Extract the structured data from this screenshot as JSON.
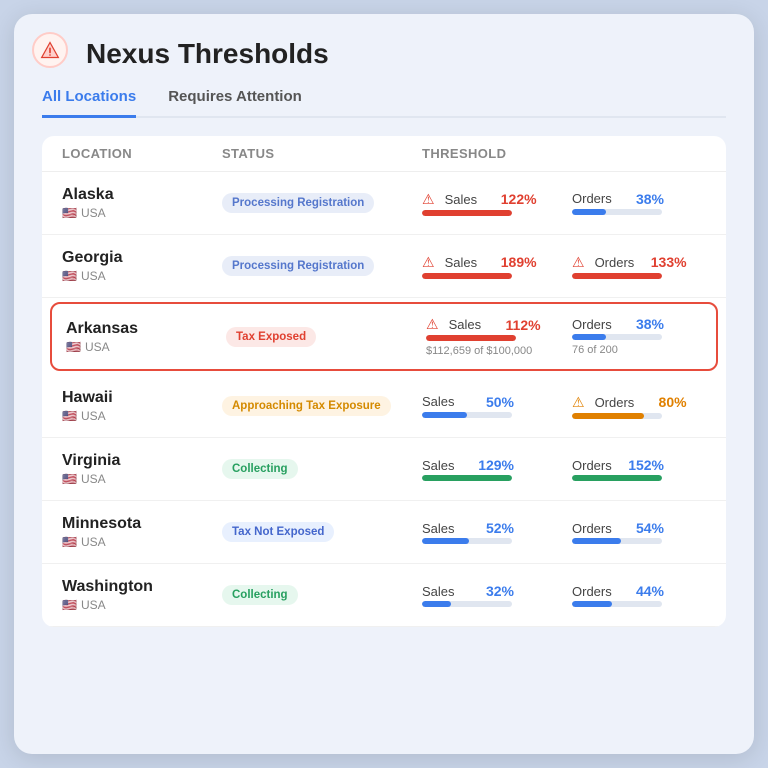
{
  "title": "Nexus Thresholds",
  "tabs": [
    {
      "label": "All Locations",
      "active": true
    },
    {
      "label": "Requires Attention",
      "active": false
    }
  ],
  "columns": [
    "Location",
    "Status",
    "Threshold"
  ],
  "rows": [
    {
      "location": "Alaska",
      "country": "USA",
      "flag": "🇺🇸",
      "status": "Processing Registration",
      "status_class": "badge-processing",
      "highlighted": false,
      "metrics": [
        {
          "label": "Sales",
          "pct": "122%",
          "pct_class": "red",
          "bar": 100,
          "bar_class": "red",
          "warn": true,
          "warn_type": "red"
        },
        {
          "label": "Orders",
          "pct": "38%",
          "pct_class": "blue",
          "bar": 38,
          "bar_class": "blue",
          "warn": false
        }
      ]
    },
    {
      "location": "Georgia",
      "country": "USA",
      "flag": "🇺🇸",
      "status": "Processing Registration",
      "status_class": "badge-processing",
      "highlighted": false,
      "metrics": [
        {
          "label": "Sales",
          "pct": "189%",
          "pct_class": "red",
          "bar": 100,
          "bar_class": "red",
          "warn": true,
          "warn_type": "red"
        },
        {
          "label": "Orders",
          "pct": "133%",
          "pct_class": "red",
          "bar": 100,
          "bar_class": "red",
          "warn": true,
          "warn_type": "red"
        }
      ]
    },
    {
      "location": "Arkansas",
      "country": "USA",
      "flag": "🇺🇸",
      "status": "Tax Exposed",
      "status_class": "badge-tax-exposed",
      "highlighted": true,
      "metrics": [
        {
          "label": "Sales",
          "pct": "112%",
          "pct_class": "red",
          "bar": 100,
          "bar_class": "red",
          "warn": true,
          "warn_type": "red",
          "sub": "$112,659 of $100,000"
        },
        {
          "label": "Orders",
          "pct": "38%",
          "pct_class": "blue",
          "bar": 38,
          "bar_class": "blue",
          "warn": false,
          "sub": "76 of 200"
        }
      ]
    },
    {
      "location": "Hawaii",
      "country": "USA",
      "flag": "🇺🇸",
      "status": "Approaching Tax Exposure",
      "status_class": "badge-approaching",
      "highlighted": false,
      "metrics": [
        {
          "label": "Sales",
          "pct": "50%",
          "pct_class": "blue",
          "bar": 50,
          "bar_class": "blue",
          "warn": false
        },
        {
          "label": "Orders",
          "pct": "80%",
          "pct_class": "orange",
          "bar": 80,
          "bar_class": "orange",
          "warn": true,
          "warn_type": "orange"
        }
      ]
    },
    {
      "location": "Virginia",
      "country": "USA",
      "flag": "🇺🇸",
      "status": "Collecting",
      "status_class": "badge-collecting",
      "highlighted": false,
      "metrics": [
        {
          "label": "Sales",
          "pct": "129%",
          "pct_class": "blue",
          "bar": 100,
          "bar_class": "green",
          "warn": false
        },
        {
          "label": "Orders",
          "pct": "152%",
          "pct_class": "blue",
          "bar": 100,
          "bar_class": "green",
          "warn": false
        }
      ]
    },
    {
      "location": "Minnesota",
      "country": "USA",
      "flag": "🇺🇸",
      "status": "Tax Not Exposed",
      "status_class": "badge-not-exposed",
      "highlighted": false,
      "metrics": [
        {
          "label": "Sales",
          "pct": "52%",
          "pct_class": "blue",
          "bar": 52,
          "bar_class": "blue",
          "warn": false
        },
        {
          "label": "Orders",
          "pct": "54%",
          "pct_class": "blue",
          "bar": 54,
          "bar_class": "blue",
          "warn": false
        }
      ]
    },
    {
      "location": "Washington",
      "country": "USA",
      "flag": "🇺🇸",
      "status": "Collecting",
      "status_class": "badge-collecting",
      "highlighted": false,
      "metrics": [
        {
          "label": "Sales",
          "pct": "32%",
          "pct_class": "blue",
          "bar": 32,
          "bar_class": "blue",
          "warn": false
        },
        {
          "label": "Orders",
          "pct": "44%",
          "pct_class": "blue",
          "bar": 44,
          "bar_class": "blue",
          "warn": false
        }
      ]
    }
  ]
}
